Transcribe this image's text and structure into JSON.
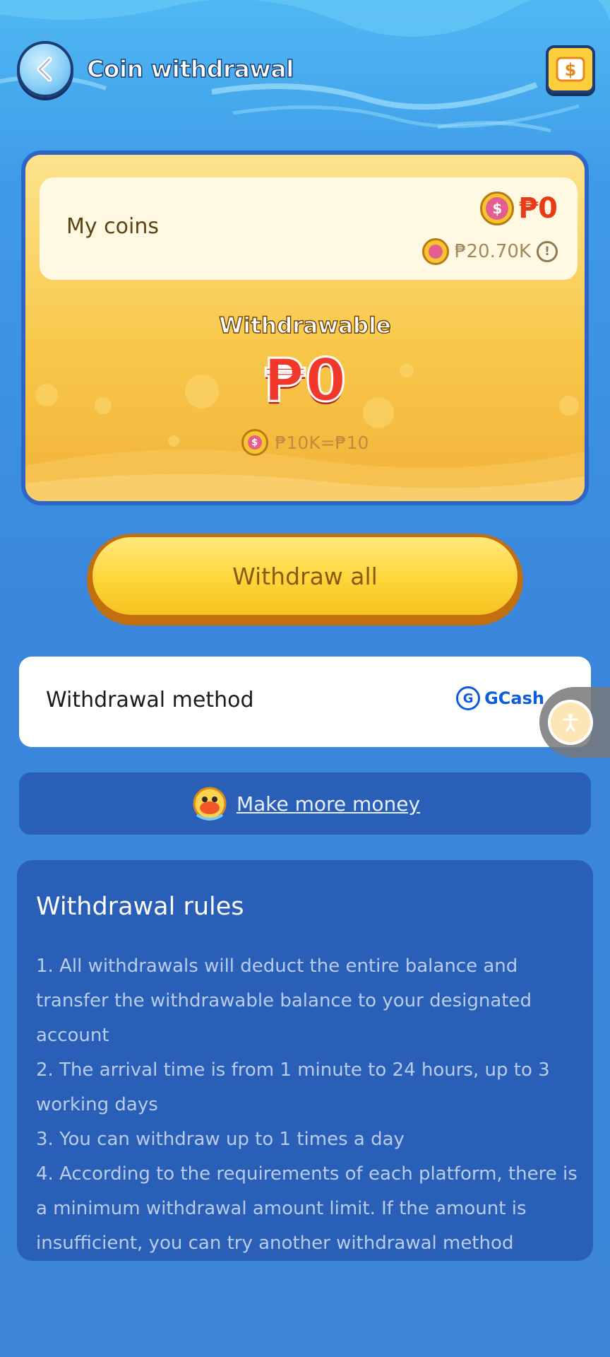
{
  "header": {
    "title": "Coin withdrawal",
    "back_icon": "chevron-left-icon",
    "wallet_icon": "dollar-wallet-icon"
  },
  "balance_card": {
    "my_coins_label": "My coins",
    "coins_value": "₱0",
    "coins_secondary": "₱20.70K",
    "withdrawable_label": "Withdrawable",
    "withdrawable_amount": "₱0",
    "range": "₱10K=₱10"
  },
  "actions": {
    "withdraw_all_label": "Withdraw all"
  },
  "method": {
    "label": "Withdrawal method",
    "provider": "GCash"
  },
  "promo": {
    "label": "Make more money"
  },
  "rules": {
    "title": "Withdrawal rules",
    "items": [
      "1. All withdrawals will deduct the entire balance and transfer the withdrawable balance to your designated account",
      "2. The arrival time is from 1 minute to 24 hours, up to 3 working days",
      "3. You can withdraw up to 1 times a day",
      "4. According to the requirements of each platform, there is a minimum withdrawal amount limit. If the amount is insufficient, you can try another withdrawal method"
    ]
  },
  "colors": {
    "background": "#3a86dc",
    "card": "#fde38e",
    "accent_red": "#e83b1c",
    "button_yellow": "#fcd63a",
    "panel_blue": "#2a5fb8"
  }
}
